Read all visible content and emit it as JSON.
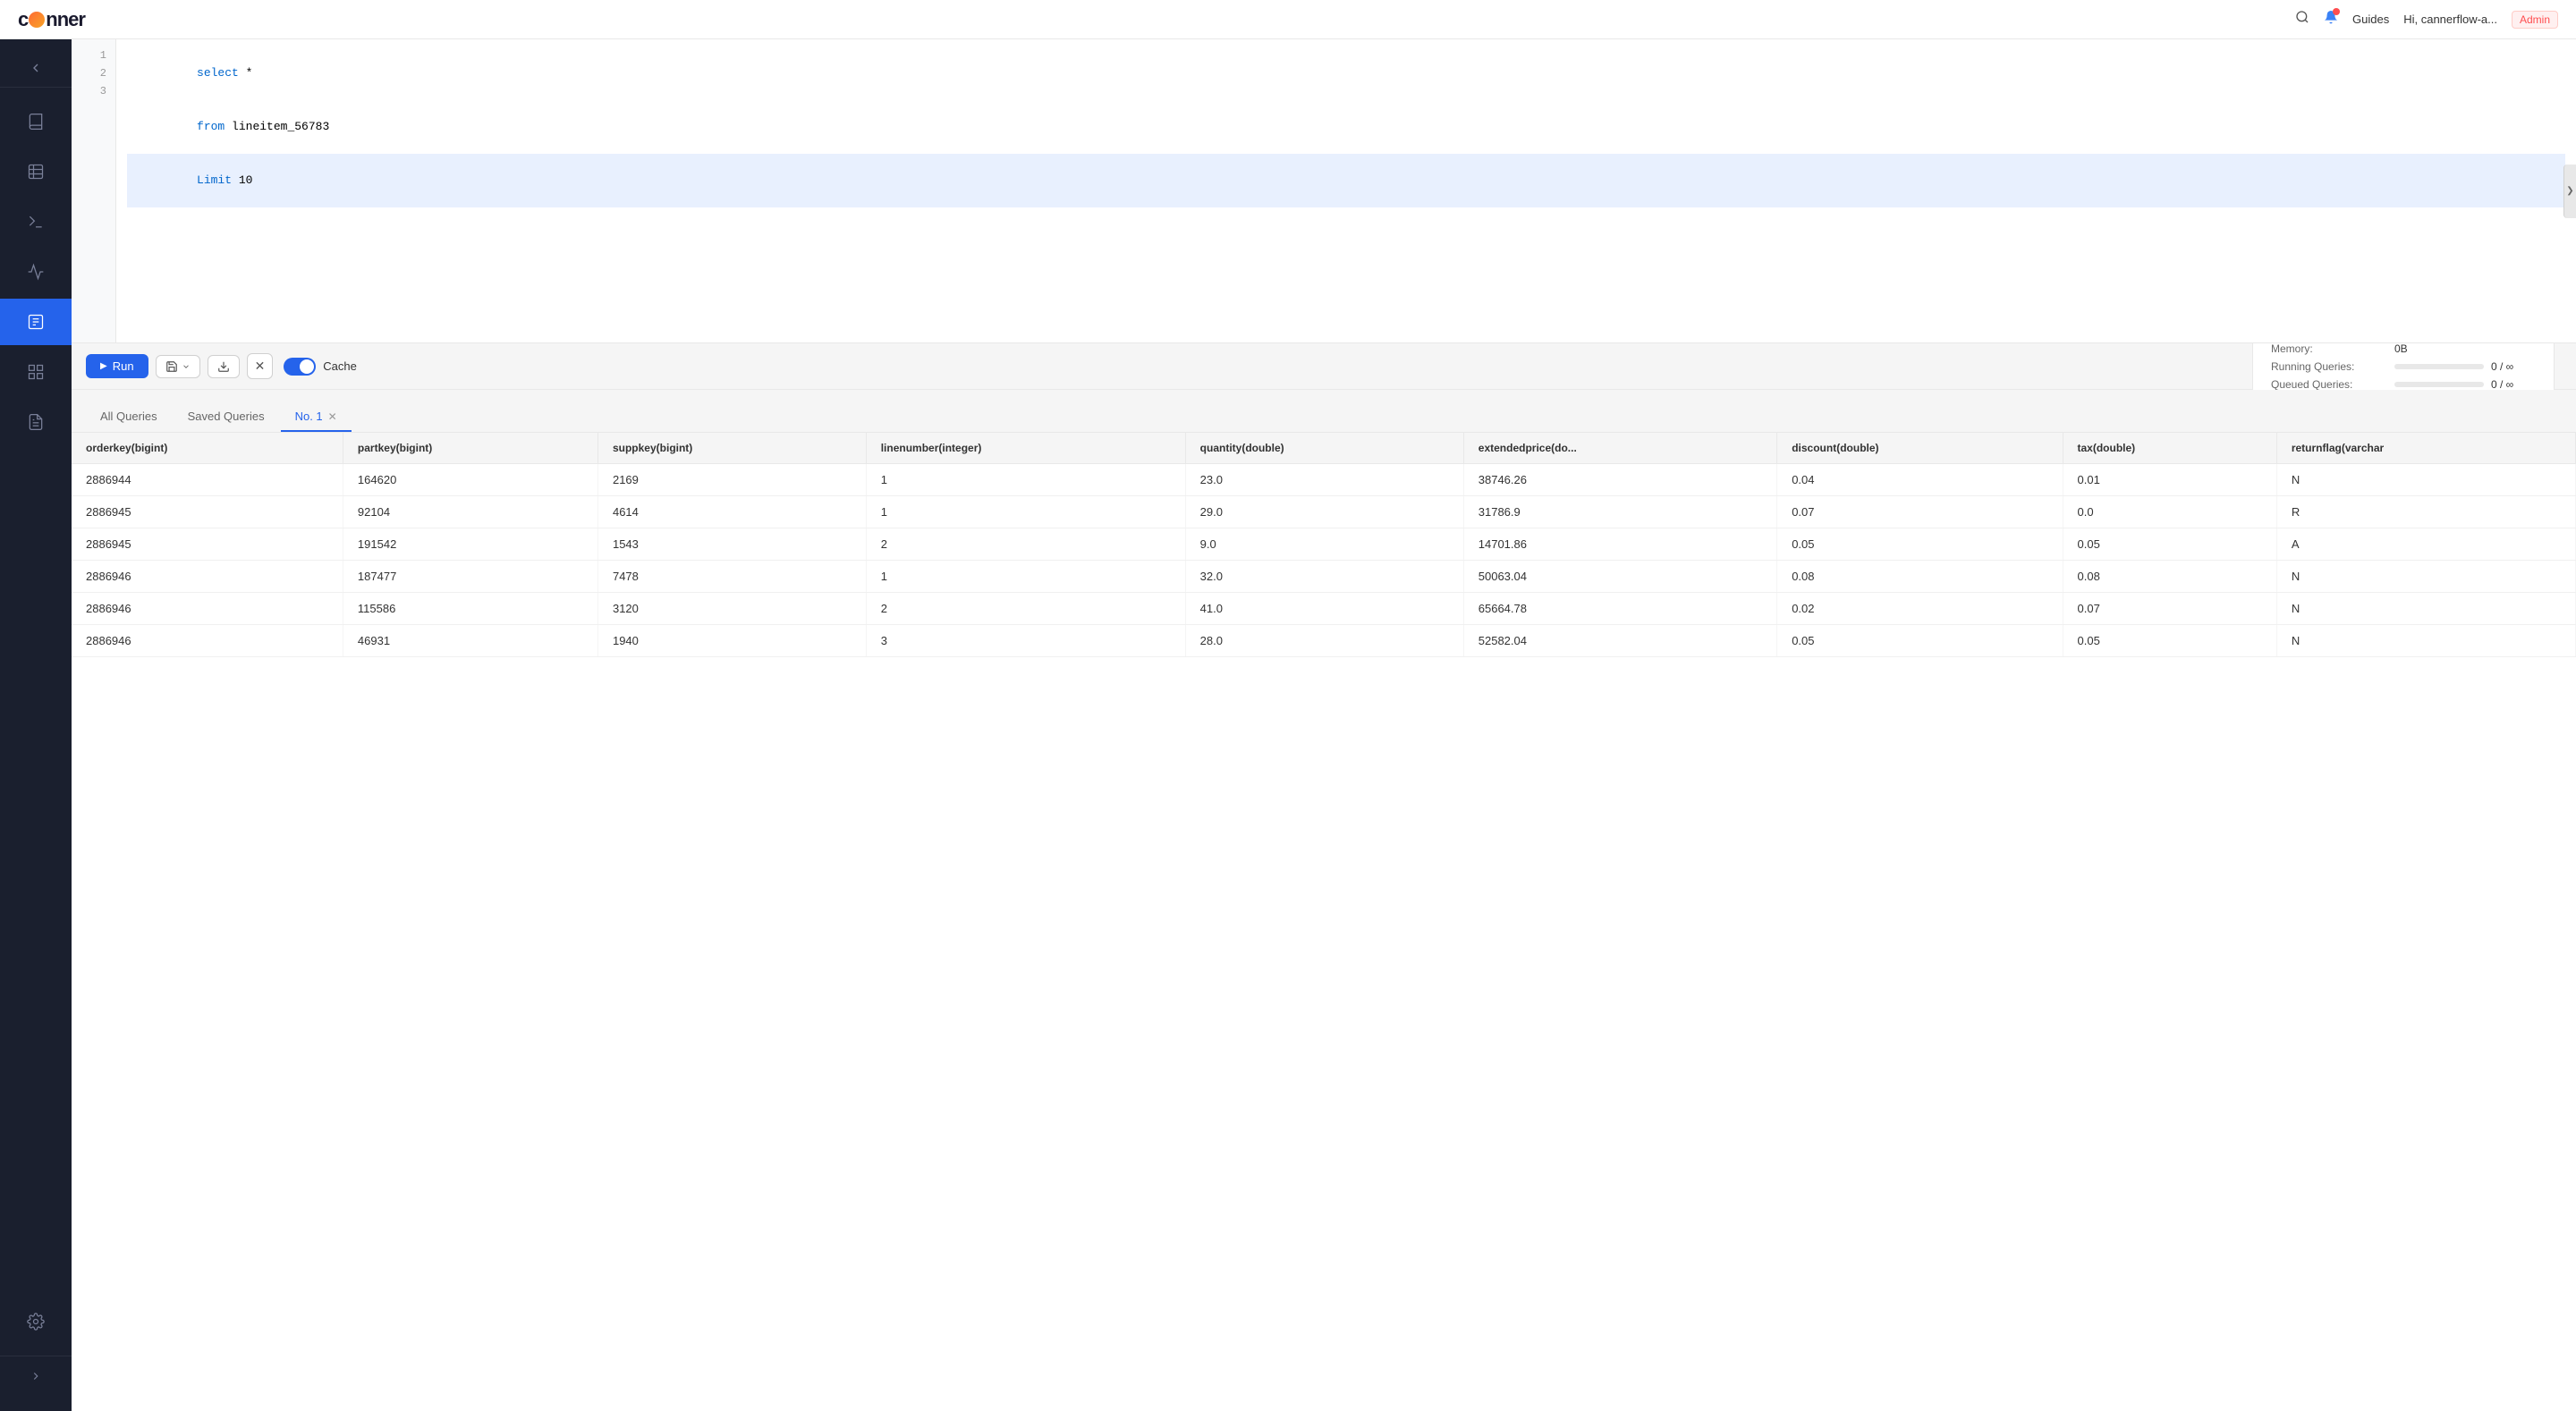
{
  "header": {
    "logo": "canner",
    "guides_label": "Guides",
    "user_label": "Hi, cannerflow-a...",
    "admin_label": "Admin"
  },
  "sidebar": {
    "back_icon": "←",
    "items": [
      {
        "id": "docs",
        "icon": "book",
        "label": "Documentation",
        "active": false
      },
      {
        "id": "table",
        "icon": "table",
        "label": "Table",
        "active": false
      },
      {
        "id": "terminal",
        "icon": "terminal",
        "label": "Terminal",
        "active": false
      },
      {
        "id": "chart",
        "icon": "chart",
        "label": "Chart",
        "active": false
      },
      {
        "id": "query",
        "icon": "query",
        "label": "Query",
        "active": true
      },
      {
        "id": "grid",
        "icon": "grid",
        "label": "Grid",
        "active": false
      },
      {
        "id": "report",
        "icon": "report",
        "label": "Report",
        "active": false
      }
    ],
    "bottom_items": [
      {
        "id": "settings",
        "icon": "gear",
        "label": "Settings"
      }
    ],
    "expand_icon": ">"
  },
  "editor": {
    "lines": [
      {
        "num": 1,
        "code": "select *",
        "highlighted": false,
        "parts": [
          {
            "type": "kw",
            "text": "select"
          },
          {
            "type": "nm",
            "text": " *"
          }
        ]
      },
      {
        "num": 2,
        "code": "from lineitem_56783",
        "highlighted": false,
        "parts": [
          {
            "type": "kw",
            "text": "from"
          },
          {
            "type": "nm",
            "text": " lineitem_56783"
          }
        ]
      },
      {
        "num": 3,
        "code": "Limit 10",
        "highlighted": true,
        "parts": [
          {
            "type": "kw",
            "text": "Limit"
          },
          {
            "type": "nm",
            "text": " 10"
          }
        ]
      }
    ]
  },
  "toolbar": {
    "run_label": "Run",
    "cache_label": "Cache",
    "cache_enabled": true
  },
  "metrics": {
    "memory_label": "Memory:",
    "memory_value": "0B",
    "running_label": "Running Queries:",
    "running_value": "0 / ∞",
    "queued_label": "Queued Queries:",
    "queued_value": "0 / ∞"
  },
  "tabs": [
    {
      "id": "all",
      "label": "All Queries",
      "active": false,
      "closable": false
    },
    {
      "id": "saved",
      "label": "Saved Queries",
      "active": false,
      "closable": false
    },
    {
      "id": "no1",
      "label": "No. 1",
      "active": true,
      "closable": true
    }
  ],
  "table": {
    "columns": [
      "orderkey(bigint)",
      "partkey(bigint)",
      "suppkey(bigint)",
      "linenumber(integer)",
      "quantity(double)",
      "extendedprice(do...",
      "discount(double)",
      "tax(double)",
      "returnflag(varchar"
    ],
    "rows": [
      [
        "2886944",
        "164620",
        "2169",
        "1",
        "23.0",
        "38746.26",
        "0.04",
        "0.01",
        "N"
      ],
      [
        "2886945",
        "92104",
        "4614",
        "1",
        "29.0",
        "31786.9",
        "0.07",
        "0.0",
        "R"
      ],
      [
        "2886945",
        "191542",
        "1543",
        "2",
        "9.0",
        "14701.86",
        "0.05",
        "0.05",
        "A"
      ],
      [
        "2886946",
        "187477",
        "7478",
        "1",
        "32.0",
        "50063.04",
        "0.08",
        "0.08",
        "N"
      ],
      [
        "2886946",
        "115586",
        "3120",
        "2",
        "41.0",
        "65664.78",
        "0.02",
        "0.07",
        "N"
      ],
      [
        "2886946",
        "46931",
        "1940",
        "3",
        "28.0",
        "52582.04",
        "0.05",
        "0.05",
        "N"
      ]
    ]
  }
}
